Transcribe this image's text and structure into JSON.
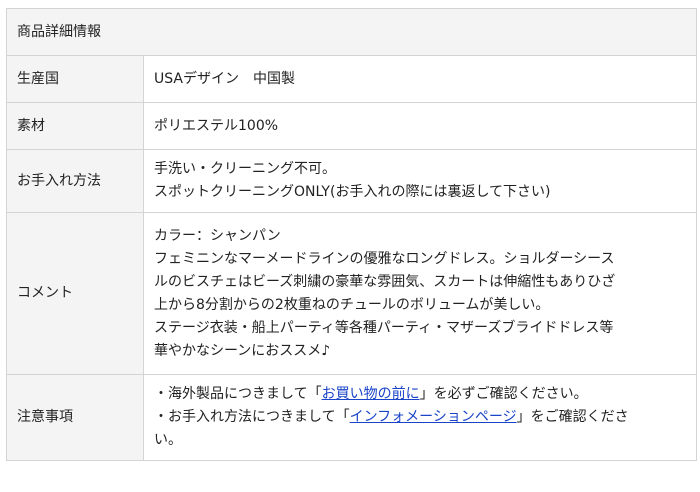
{
  "table": {
    "title": "商品詳細情報",
    "rows": {
      "origin": {
        "label": "生産国",
        "value": "USAデザイン　中国製"
      },
      "material": {
        "label": "素材",
        "value": "ポリエステル100%"
      },
      "care": {
        "label": "お手入れ方法",
        "lines": [
          "手洗い・クリーニング不可。",
          "スポットクリーニングONLY(お手入れの際には裏返して下さい)"
        ]
      },
      "comment": {
        "label": "コメント",
        "lines": [
          "カラー：シャンパン",
          "フェミニンなマーメードラインの優雅なロングドレス。ショルダーシース",
          "ルのビスチェはビーズ刺繍の豪華な雰囲気、スカートは伸縮性もありひざ",
          "上から8分割からの2枚重ねのチュールのボリュームが美しい。",
          "ステージ衣装・船上パーティ等各種パーティ・マザーズブライドドレス等",
          "華やかなシーンにおススメ♪"
        ]
      },
      "notes": {
        "label": "注意事項",
        "note1": {
          "prefix": "・海外製品につきまして「",
          "link": "お買い物の前に",
          "suffix": "」を必ずご確認ください。"
        },
        "note2": {
          "prefix": "・お手入れ方法につきまして「",
          "link": "インフォメーションページ",
          "suffix_line1": "」をご確認くださ",
          "suffix_line2": "い。"
        }
      }
    }
  },
  "colors": {
    "header_bg": "#f4f4f4",
    "border": "#d4d4d4",
    "link": "#1a44c8",
    "text": "#222222"
  }
}
